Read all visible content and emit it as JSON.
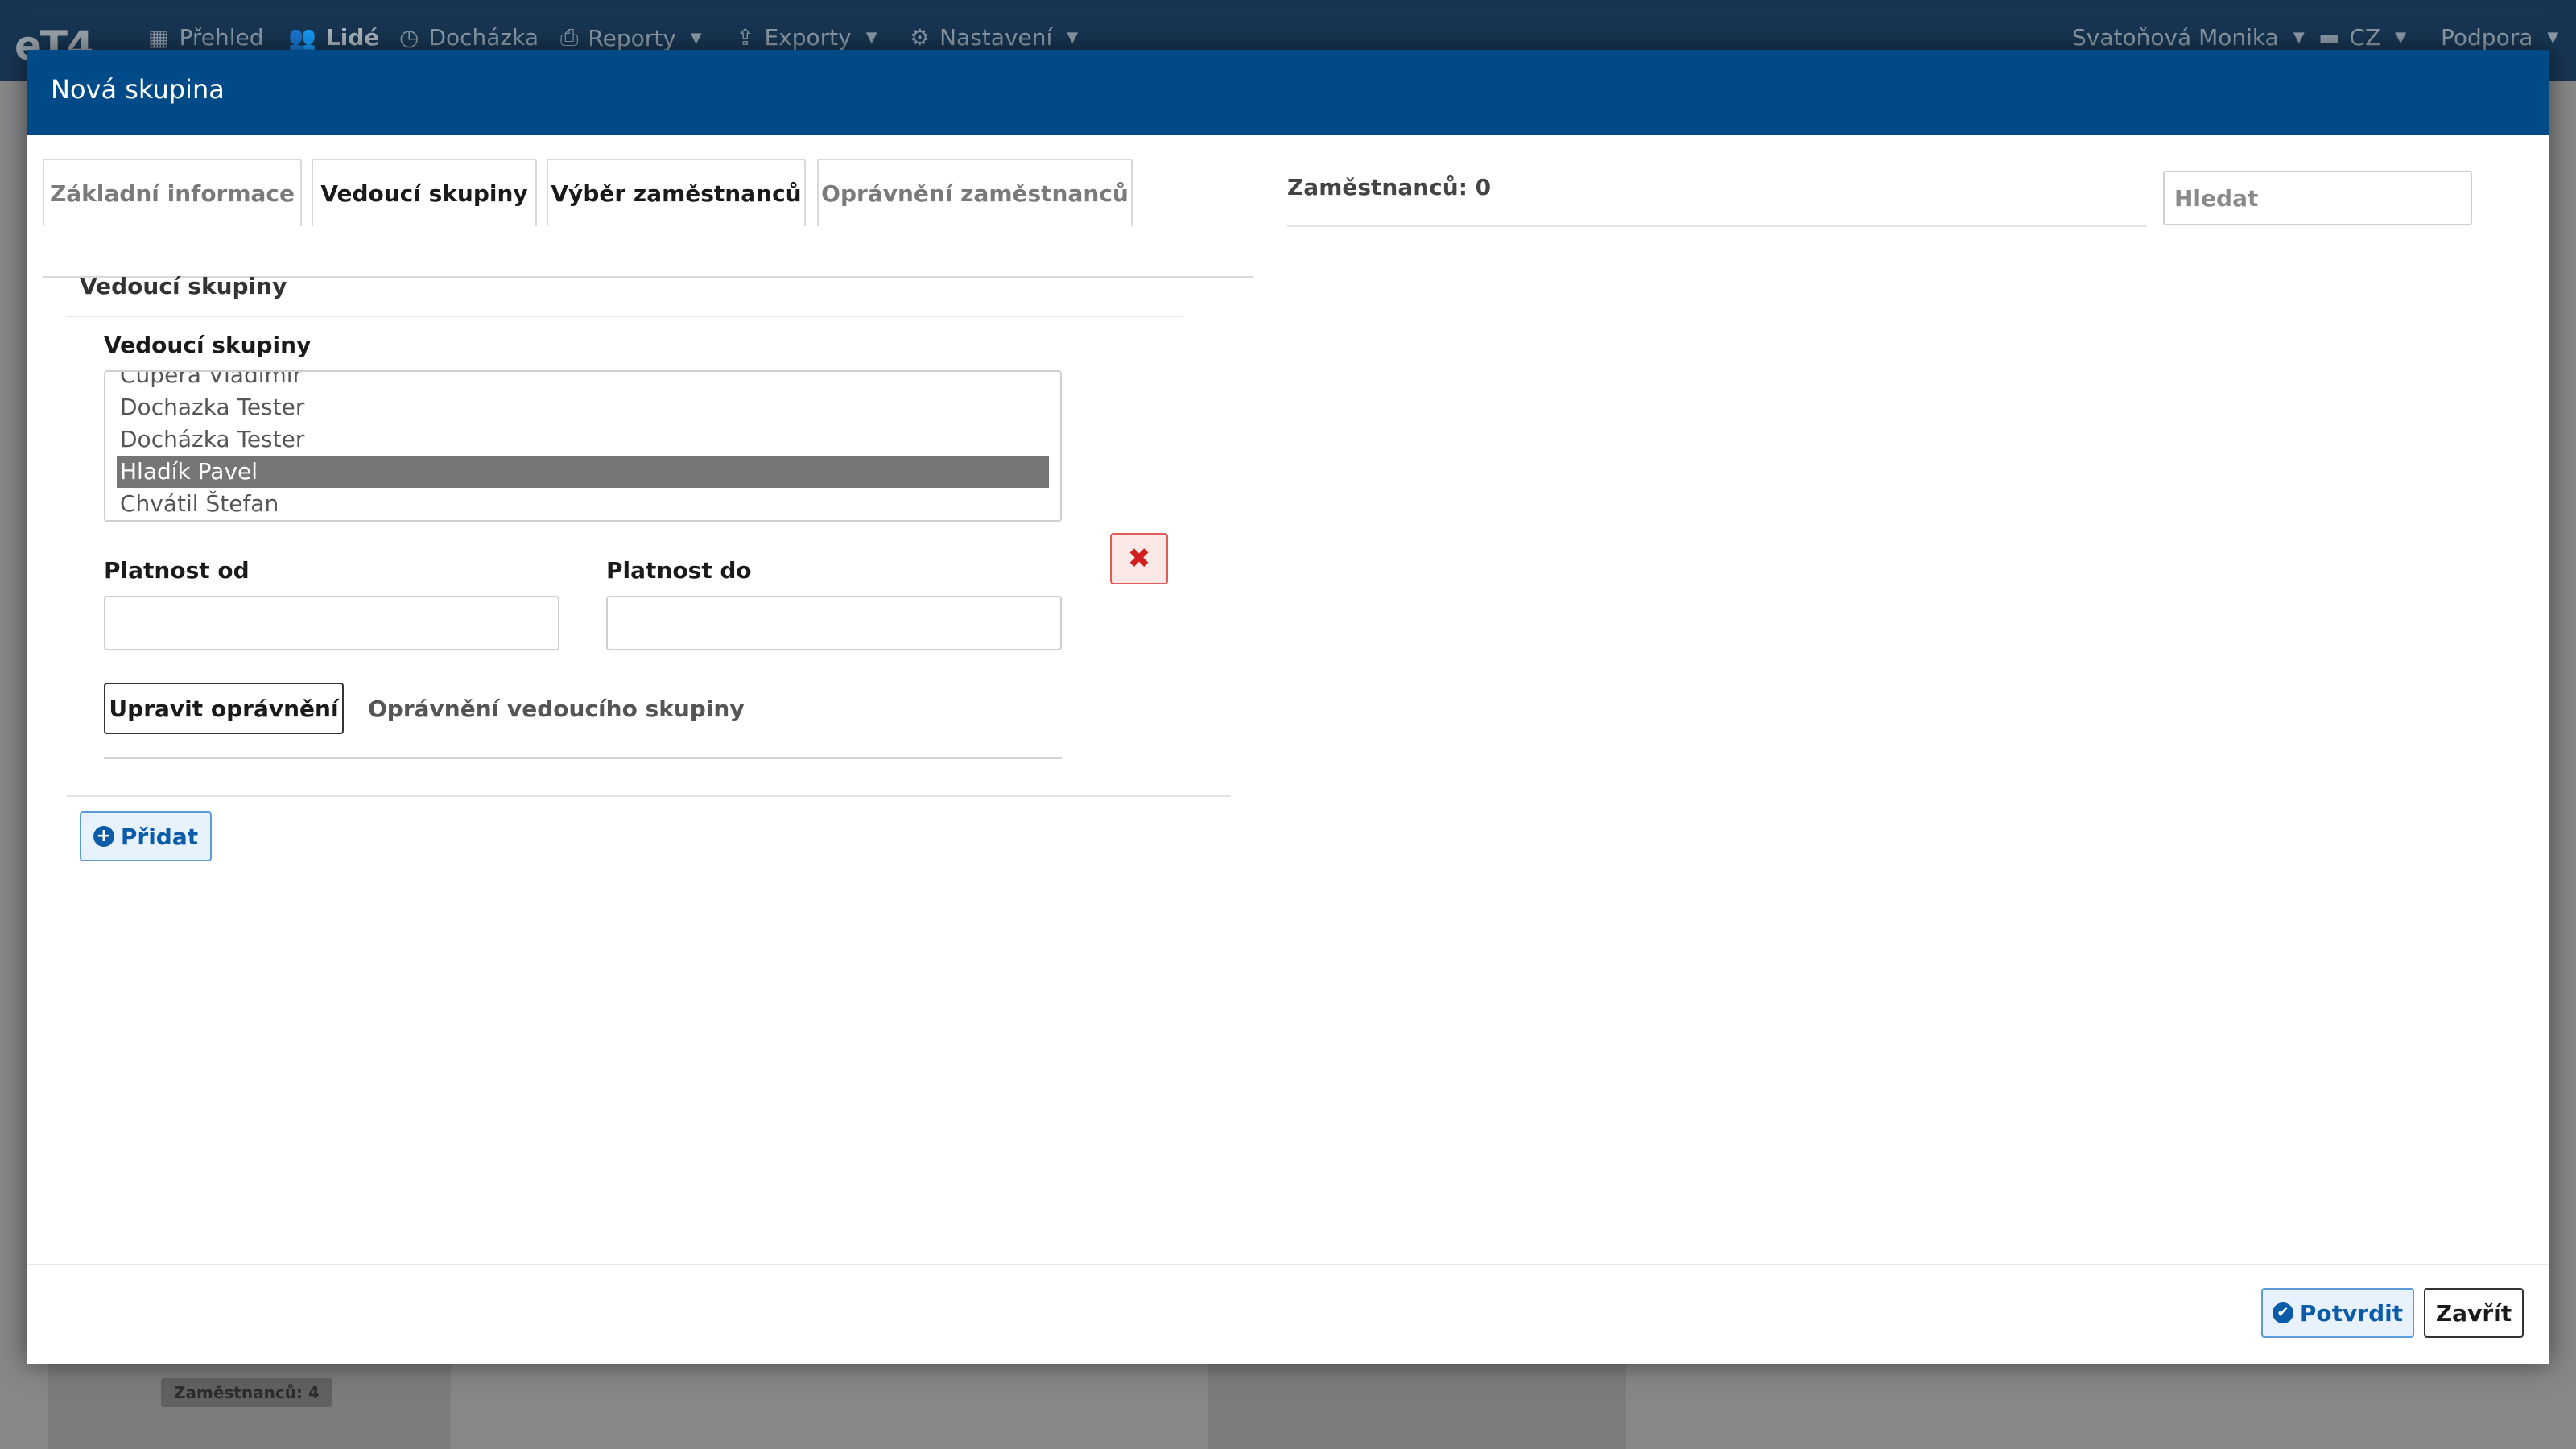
{
  "nav": {
    "items": [
      {
        "icon": "grid-icon",
        "label": "Přehled"
      },
      {
        "icon": "users-icon",
        "label": "Lidé"
      },
      {
        "icon": "clock-icon",
        "label": "Docházka"
      },
      {
        "icon": "printer-icon",
        "label": "Reporty"
      },
      {
        "icon": "export-icon",
        "label": "Exporty"
      },
      {
        "icon": "gear-icon",
        "label": "Nastavení"
      }
    ],
    "user": "Svatoňová Monika",
    "language": "CZ",
    "support": "Podpora"
  },
  "background": {
    "badge": "Zaměstnanců: 4"
  },
  "modal": {
    "title": "Nová skupina",
    "tabs": [
      {
        "label": "Základní informace"
      },
      {
        "label": "Vedoucí skupiny"
      },
      {
        "label": "Výběr zaměstnanců"
      },
      {
        "label": "Oprávnění zaměstnanců"
      }
    ],
    "section_title": "Vedoucí skupiny",
    "leader_label": "Vedoucí skupiny",
    "leader_options": [
      "Čupera Vladimír",
      "Dochazka Tester",
      "Docházka Tester",
      "Hladík Pavel",
      "Chvátil Štefan"
    ],
    "selected_option": "Hladík Pavel",
    "valid_from_label": "Platnost od",
    "valid_to_label": "Platnost do",
    "edit_permissions_button": "Upravit oprávnění",
    "leader_permissions_label": "Oprávnění vedoucího skupiny",
    "add_button": "Přidat",
    "employee_count": "Zaměstnanců: 0",
    "search_placeholder": "Hledat",
    "confirm_button": "Potvrdit",
    "close_button": "Zavřít"
  }
}
